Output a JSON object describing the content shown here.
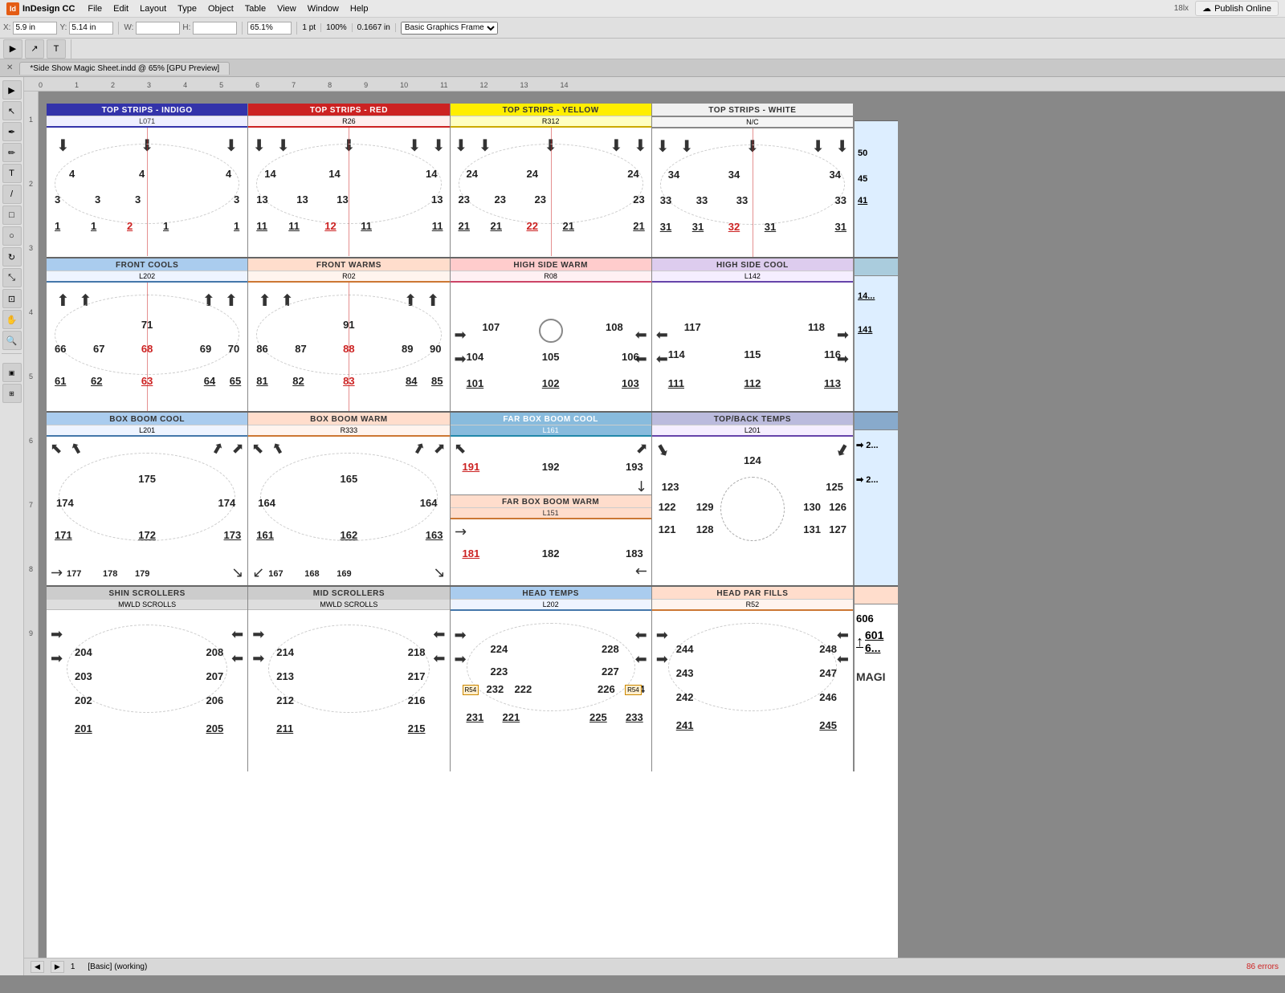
{
  "app": {
    "name": "InDesign CC",
    "file": "*Side Show Magic Sheet.indd @ 65% [GPU Preview]",
    "zoom": "65.1%",
    "errors": "86 errors"
  },
  "menubar": {
    "apple": "🍎",
    "items": [
      "InDesign CC",
      "File",
      "Edit",
      "Layout",
      "Type",
      "Object",
      "Table",
      "View",
      "Window",
      "Help"
    ],
    "publish": "Publish Online"
  },
  "toolbar": {
    "x_label": "X:",
    "x_value": "5.9 in",
    "y_label": "Y:",
    "y_value": "5.14 in",
    "w_label": "W:",
    "h_label": "H:"
  },
  "panels": {
    "row1": [
      {
        "title": "TOP STRIPS - INDIGO",
        "code": "L071",
        "header_class": "header-indigo",
        "code_class": "code-indigo",
        "numbers": [
          "4",
          "4",
          "4",
          "3",
          "3",
          "3",
          "3",
          "1",
          "1",
          "2",
          "1",
          "1"
        ],
        "underlined": [
          "1",
          "1",
          "2",
          "1",
          "1"
        ]
      },
      {
        "title": "TOP STRIPS - RED",
        "code": "R26",
        "header_class": "header-red",
        "code_class": "code-red",
        "numbers": [
          "14",
          "14",
          "14",
          "13",
          "13",
          "13",
          "13",
          "11",
          "11",
          "12",
          "11",
          "11"
        ],
        "underlined": [
          "11",
          "11",
          "12",
          "11",
          "11"
        ]
      },
      {
        "title": "TOP STRIPS - YELLOW",
        "code": "R312",
        "header_class": "header-yellow",
        "code_class": "code-yellow",
        "numbers": [
          "24",
          "24",
          "24",
          "23",
          "23",
          "23",
          "23",
          "21",
          "21",
          "22",
          "21",
          "21"
        ],
        "underlined": [
          "21",
          "21",
          "22",
          "21",
          "21"
        ]
      },
      {
        "title": "TOP STRIPS - WHITE",
        "code": "N/C",
        "header_class": "header-white-bg",
        "code_class": "code-gray",
        "numbers": [
          "34",
          "34",
          "34",
          "33",
          "33",
          "33",
          "33",
          "31",
          "31",
          "32",
          "31",
          "31"
        ],
        "underlined": [
          "31",
          "31",
          "32",
          "31",
          "31"
        ]
      }
    ],
    "row2": [
      {
        "title": "FRONT COOLS",
        "code": "L202",
        "header_class": "header-blue-lt",
        "code_class": "code-blue",
        "numbers": [
          "71",
          "66",
          "67",
          "68",
          "69",
          "70",
          "61",
          "62",
          "63",
          "64",
          "65"
        ],
        "underlined": [
          "61",
          "62",
          "63",
          "64",
          "65"
        ]
      },
      {
        "title": "FRONT WARMS",
        "code": "R02",
        "header_class": "header-orange-lt",
        "code_class": "code-orange",
        "numbers": [
          "91",
          "86",
          "87",
          "88",
          "89",
          "90",
          "81",
          "82",
          "83",
          "84",
          "85"
        ],
        "underlined": [
          "81",
          "82",
          "83",
          "84",
          "85"
        ]
      },
      {
        "title": "HIGH SIDE WARM",
        "code": "R08",
        "header_class": "header-pink-lt",
        "code_class": "code-pink",
        "numbers": [
          "107",
          "108",
          "104",
          "105",
          "106",
          "101",
          "102",
          "103"
        ],
        "underlined": [
          "101",
          "102",
          "103"
        ]
      },
      {
        "title": "HIGH SIDE COOL",
        "code": "L142",
        "header_class": "header-purple-lt",
        "code_class": "code-purple",
        "numbers": [
          "117",
          "118",
          "114",
          "115",
          "116",
          "111",
          "112",
          "113"
        ],
        "underlined": [
          "111",
          "112",
          "113"
        ]
      }
    ],
    "row3": [
      {
        "title": "BOX BOOM COOL",
        "code": "L201",
        "header_class": "header-blue-lt",
        "code_class": "code-blue",
        "numbers": [
          "175",
          "174",
          "174",
          "171",
          "172",
          "173",
          "177",
          "178",
          "179"
        ],
        "underlined": [
          "171",
          "172",
          "173"
        ]
      },
      {
        "title": "BOX BOOM WARM",
        "code": "R333",
        "header_class": "header-orange-lt",
        "code_class": "code-orange",
        "numbers": [
          "165",
          "164",
          "164",
          "161",
          "162",
          "163",
          "167",
          "168",
          "169"
        ],
        "underlined": [
          "161",
          "162",
          "163"
        ]
      },
      {
        "title": "FAR BOX BOOM COOL",
        "code": "L161",
        "header_class": "header-skyblue",
        "code_class": "code-cyan",
        "numbers": [
          "191",
          "192",
          "193"
        ],
        "sub_title": "FAR BOX BOOM WARM",
        "sub_code": "L151",
        "sub_numbers": [
          "181",
          "182",
          "183"
        ]
      },
      {
        "title": "TOP/BACK TEMPS",
        "code": "L201",
        "header_class": "header-lavender",
        "code_class": "code-purple",
        "numbers": [
          "124",
          "123",
          "125",
          "122",
          "129",
          "130",
          "126",
          "121",
          "128",
          "131",
          "127"
        ]
      }
    ],
    "row4": [
      {
        "title": "SHIN SCROLLERS",
        "sub": "MWLD SCROLLS",
        "header_class": "header-gray",
        "code_class": "code-gray",
        "numbers": [
          "204",
          "208",
          "203",
          "207",
          "202",
          "206",
          "201",
          "205"
        ],
        "underlined": [
          "201",
          "205"
        ]
      },
      {
        "title": "MID SCROLLERS",
        "sub": "MWLD SCROLLS",
        "header_class": "header-gray",
        "code_class": "code-gray",
        "numbers": [
          "214",
          "218",
          "213",
          "217",
          "212",
          "216",
          "211",
          "215"
        ],
        "underlined": [
          "211",
          "215"
        ]
      },
      {
        "title": "HEAD TEMPS",
        "code": "L202",
        "header_class": "header-blue-lt",
        "code_class": "code-blue",
        "numbers": [
          "224",
          "228",
          "223",
          "227",
          "232",
          "222",
          "226",
          "234",
          "231",
          "221",
          "225",
          "233"
        ],
        "underlined": [
          "231",
          "221",
          "225",
          "233"
        ],
        "special": [
          "R54",
          "R54"
        ]
      },
      {
        "title": "HEAD PAR FILLS",
        "code": "R52",
        "header_class": "header-orange-lt",
        "code_class": "code-orange",
        "numbers": [
          "244",
          "248",
          "243",
          "247",
          "242",
          "246",
          "241",
          "245"
        ],
        "underlined": [
          "241",
          "245"
        ]
      }
    ]
  },
  "statusbar": {
    "page": "1",
    "mode": "[Basic] (working)",
    "errors": "86 errors"
  }
}
